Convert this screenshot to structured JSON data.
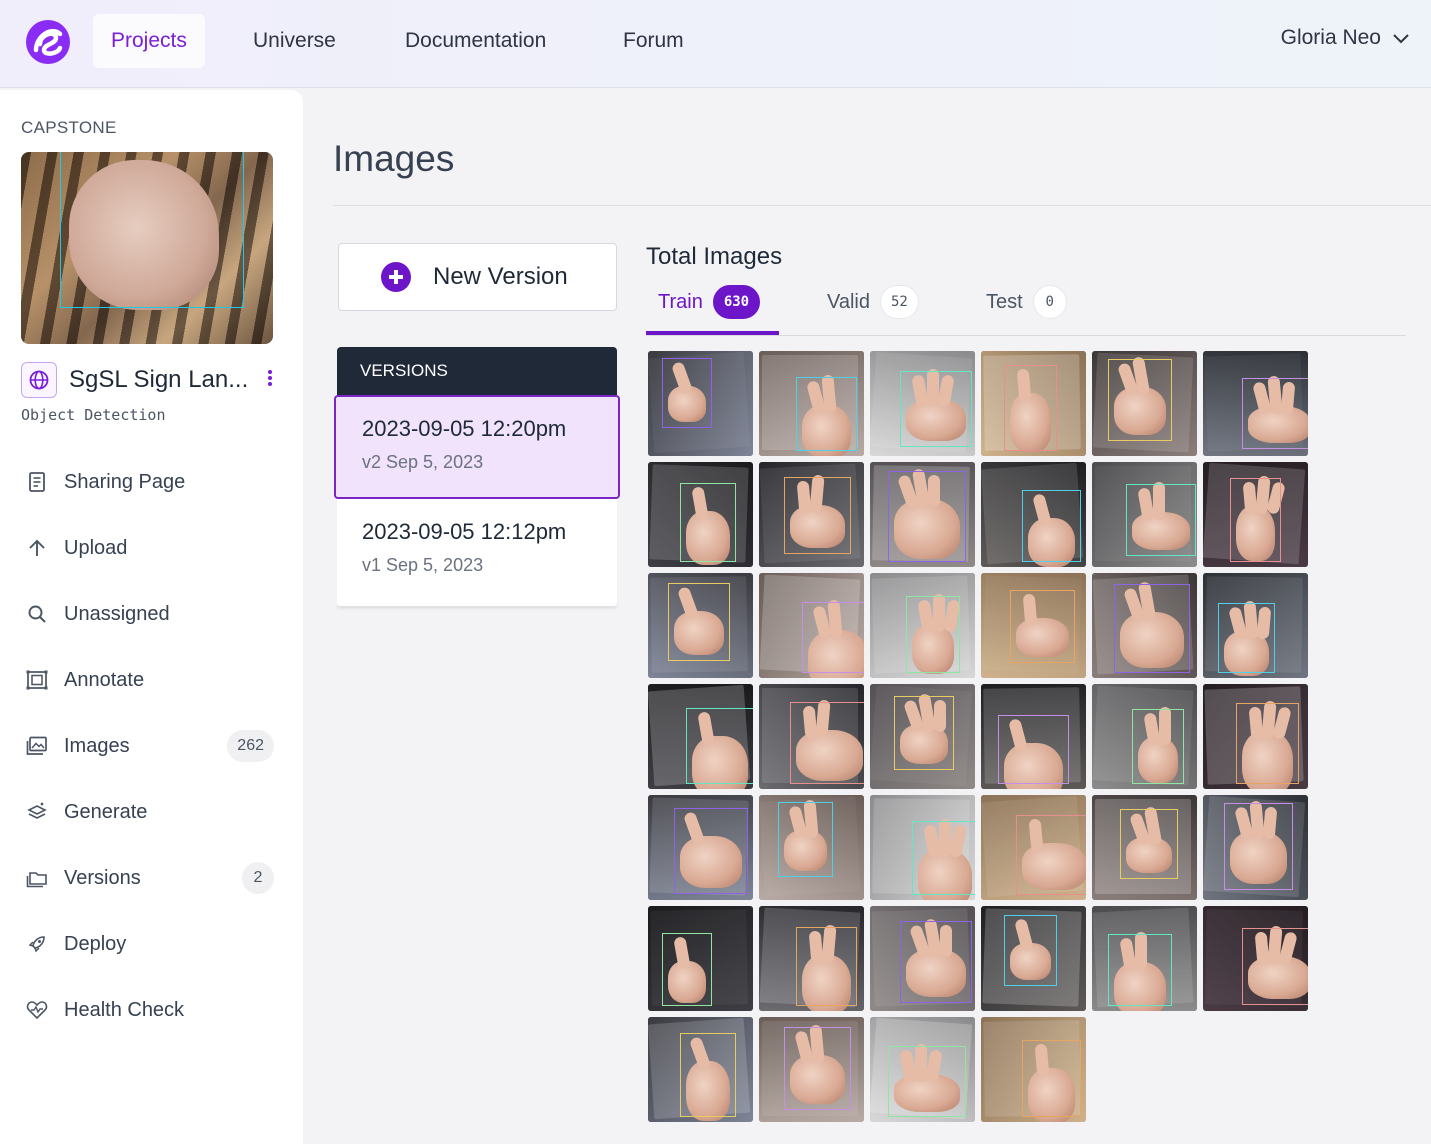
{
  "nav": {
    "items": [
      "Projects",
      "Universe",
      "Documentation",
      "Forum"
    ],
    "active": "Projects",
    "user": "Gloria Neo"
  },
  "sidebar": {
    "workspace": "CAPSTONE",
    "project_name": "SgSL Sign Lan...",
    "project_type": "Object Detection",
    "menu": [
      {
        "label": "Sharing Page",
        "icon": "document-icon"
      },
      {
        "label": "Upload",
        "icon": "arrow-up-icon"
      },
      {
        "label": "Unassigned",
        "icon": "search-icon"
      },
      {
        "label": "Annotate",
        "icon": "annotate-icon"
      },
      {
        "label": "Images",
        "icon": "images-icon",
        "count": "262"
      },
      {
        "label": "Generate",
        "icon": "generate-icon"
      },
      {
        "label": "Versions",
        "icon": "folder-icon",
        "count": "2"
      },
      {
        "label": "Deploy",
        "icon": "rocket-icon"
      },
      {
        "label": "Health Check",
        "icon": "heart-pulse-icon"
      }
    ]
  },
  "main": {
    "title": "Images",
    "new_version_label": "New Version",
    "versions_header": "VERSIONS",
    "versions": [
      {
        "date": "2023-09-05 12:20pm",
        "sub": "v2 Sep 5, 2023",
        "selected": true
      },
      {
        "date": "2023-09-05 12:12pm",
        "sub": "v1 Sep 5, 2023",
        "selected": false
      }
    ],
    "total_images_label": "Total Images",
    "tabs": [
      {
        "label": "Train",
        "count": "630",
        "active": true
      },
      {
        "label": "Valid",
        "count": "52",
        "active": false
      },
      {
        "label": "Test",
        "count": "0",
        "active": false
      }
    ],
    "thumbnail_count": 40,
    "colors": {
      "accent": "#6d15c9",
      "dark": "#1f2937",
      "brand": "#8b2cf5"
    }
  }
}
